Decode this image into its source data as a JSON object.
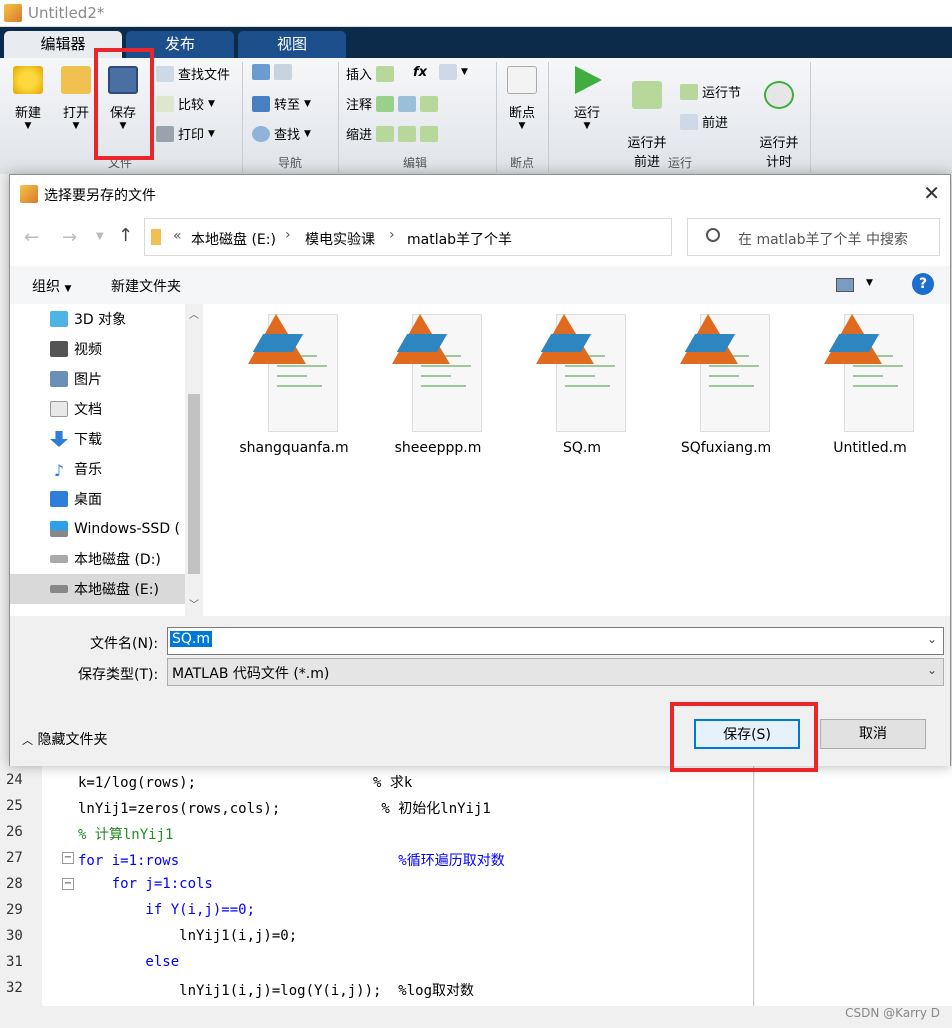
{
  "window": {
    "title": "Untitled2*"
  },
  "ribbon": {
    "tabs": [
      "编辑器",
      "发布",
      "视图"
    ],
    "file_group": {
      "new": "新建",
      "open": "打开",
      "save": "保存",
      "find_files": "查找文件",
      "compare": "比较",
      "print": "打印",
      "label": "文件"
    },
    "nav_group": {
      "goto": "转至",
      "find": "查找",
      "label": "导航"
    },
    "edit_group": {
      "insert": "插入",
      "comment": "注释",
      "indent": "缩进",
      "fx": "fx",
      "label": "编辑"
    },
    "breakpoint_group": {
      "breakpoints": "断点",
      "label": "断点"
    },
    "run_group": {
      "run": "运行",
      "run_advance": "运行并\n前进",
      "run_section": "运行节",
      "advance": "前进",
      "run_time": "运行并\n计时",
      "label": "运行"
    }
  },
  "dialog": {
    "title": "选择要另存的文件",
    "breadcrumb": [
      "本地磁盘 (E:)",
      "模电实验课",
      "matlab羊了个羊"
    ],
    "search_placeholder": "在 matlab羊了个羊 中搜索",
    "organize": "组织",
    "new_folder": "新建文件夹",
    "tree": [
      "3D 对象",
      "视频",
      "图片",
      "文档",
      "下载",
      "音乐",
      "桌面",
      "Windows-SSD (",
      "本地磁盘 (D:)",
      "本地磁盘 (E:)"
    ],
    "files": [
      "shangquanfa.m",
      "sheeeppp.m",
      "SQ.m",
      "SQfuxiang.m",
      "Untitled.m"
    ],
    "filename_label": "文件名(N):",
    "filename_value": "SQ.m",
    "filetype_label": "保存类型(T):",
    "filetype_value": "MATLAB 代码文件 (*.m)",
    "hide_folders": "隐藏文件夹",
    "save_button": "保存(S)",
    "cancel_button": "取消"
  },
  "editor": {
    "lines": [
      {
        "n": "24",
        "t": "k=1/log(rows);                     % 求k"
      },
      {
        "n": "25",
        "t": "lnYij1=zeros(rows,cols);            % 初始化lnYij1"
      },
      {
        "n": "26",
        "t": "% 计算lnYij1"
      },
      {
        "n": "27",
        "t": "for i=1:rows                          %循环遍历取对数"
      },
      {
        "n": "28",
        "t": "    for j=1:cols"
      },
      {
        "n": "29",
        "t": "        if Y(i,j)==0;"
      },
      {
        "n": "30",
        "t": "            lnYij1(i,j)=0;"
      },
      {
        "n": "31",
        "t": "        else"
      },
      {
        "n": "32",
        "t": "            lnYij1(i,j)=log(Y(i,j));  %log取对数"
      }
    ]
  },
  "watermark": "CSDN @Karry D"
}
